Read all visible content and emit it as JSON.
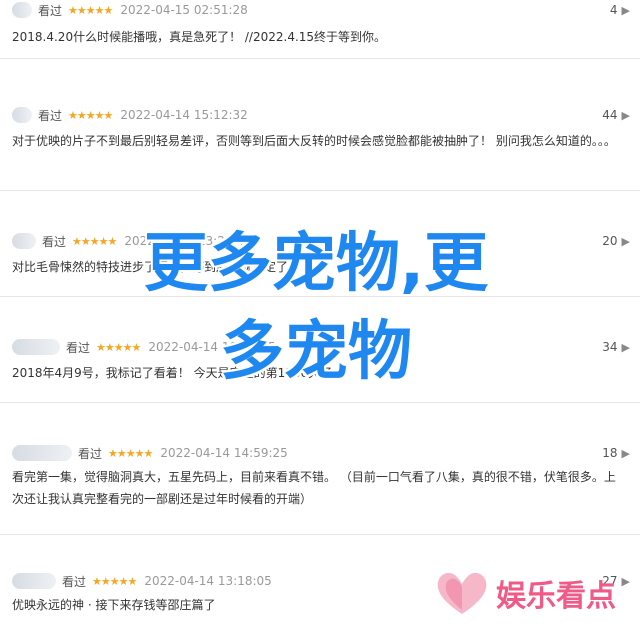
{
  "comments": [
    {
      "status": "看过",
      "stars": "★★★★★",
      "time": "2022-04-15 02:51:28",
      "votes": "4",
      "text": "2018.4.20什么时候能播哦，真是急死了！ //2022.4.15终于等到你。"
    },
    {
      "status": "看过",
      "stars": "★★★★★",
      "time": "2022-04-14 15:12:32",
      "votes": "44",
      "text": "对于优映的片子不到最后别轻易差评，否则等到后面大反转的时候会感觉脸都能被抽肿了！  别问我怎么知道的。。。"
    },
    {
      "status": "看过",
      "stars": "★★★★★",
      "time": "2022-04-14 13:26:43",
      "votes": "20",
      "text": "对比毛骨悚然的特技进步了不少，等到后来就预定了"
    },
    {
      "status": "看过",
      "stars": "★★★★★",
      "time": "2022-04-14 19:03:15",
      "votes": "34",
      "text": "2018年4月9号，我标记了看着！  今天是完整的第1166天了"
    },
    {
      "status": "看过",
      "stars": "★★★★★",
      "time": "2022-04-14 14:59:25",
      "votes": "18",
      "text": "看完第一集，觉得脑洞真大，五星先码上，目前来看真不错。  （目前一口气看了八集，真的很不错，伏笔很多。上次还让我认真完整看完的一部剧还是过年时候看的开端）"
    },
    {
      "status": "看过",
      "stars": "★★★★★",
      "time": "2022-04-14 13:18:05",
      "votes": "27",
      "text": "优映永远的神 · 接下来存钱等邵庄篇了"
    }
  ],
  "watermark": {
    "line1": "更多宠物,更",
    "line2": "多宠物"
  },
  "brand": {
    "text": "娱乐看点"
  },
  "colors": {
    "star": "#f5a623",
    "watermark": "#1e88f0",
    "brand": "#ef5a87"
  }
}
